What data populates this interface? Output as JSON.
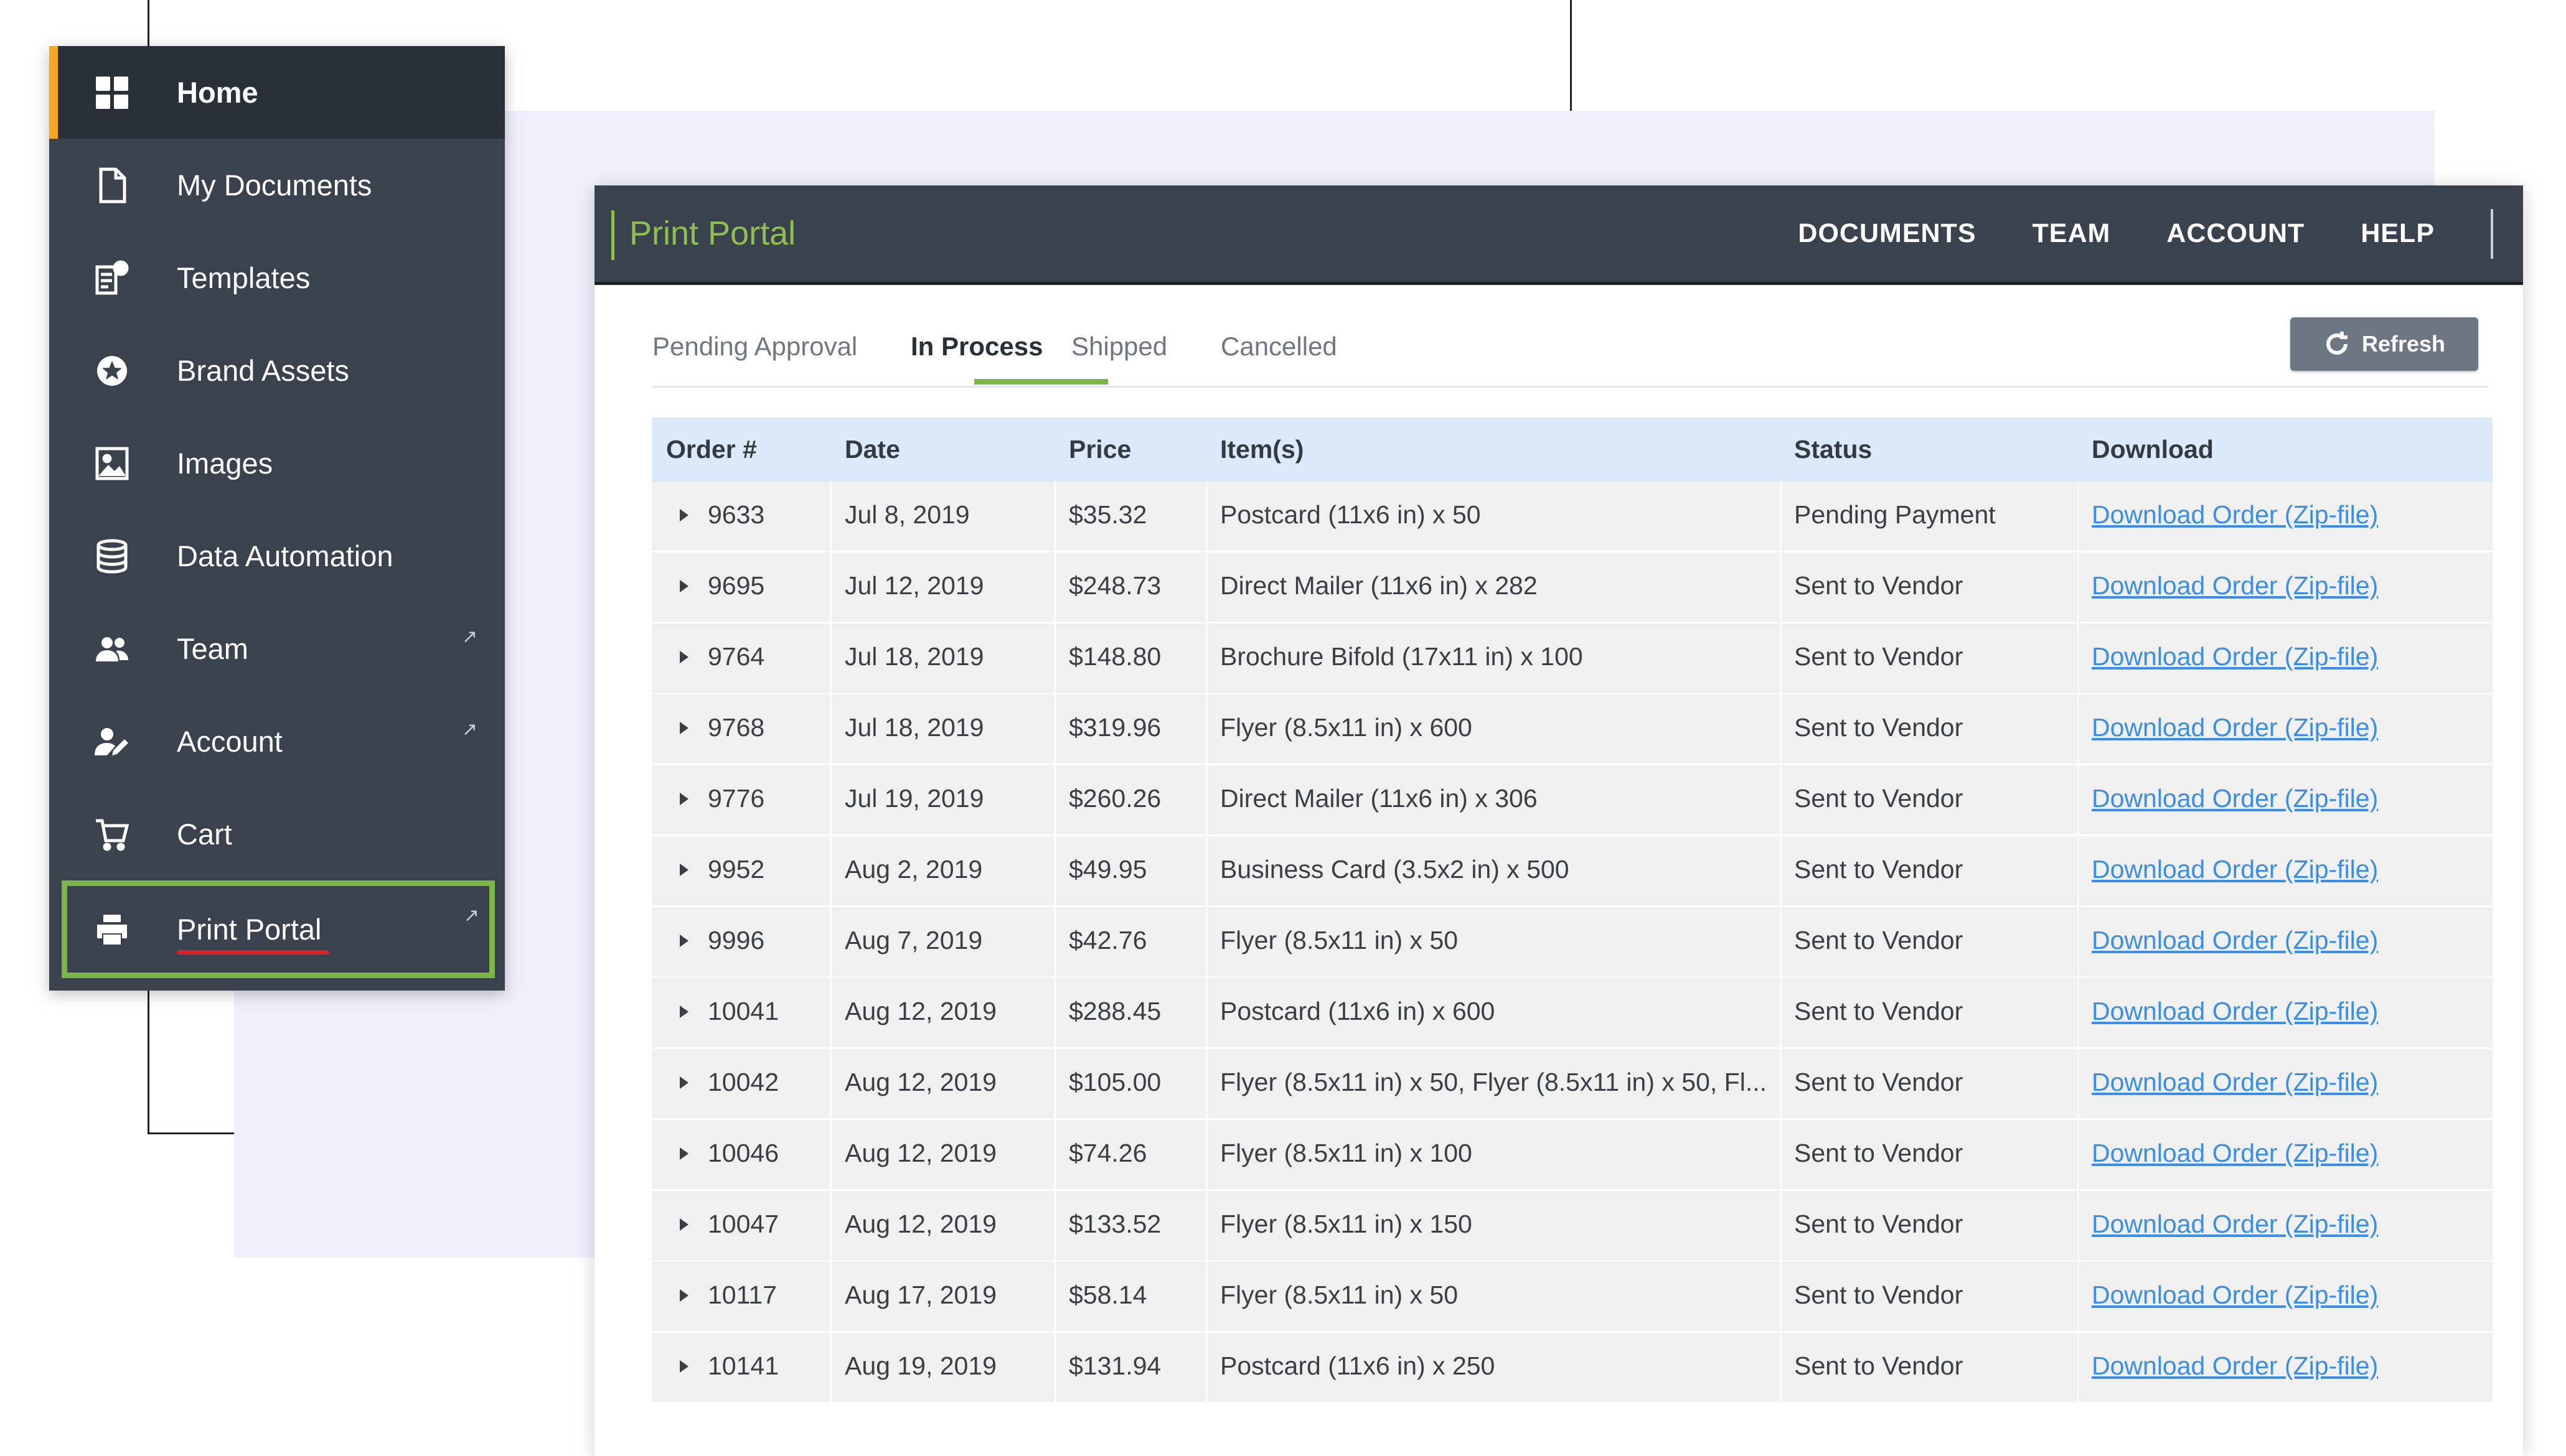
{
  "sidebar": {
    "items": [
      {
        "label": "Home",
        "icon": "grid-icon",
        "active": true
      },
      {
        "label": "My Documents",
        "icon": "document-icon"
      },
      {
        "label": "Templates",
        "icon": "template-icon"
      },
      {
        "label": "Brand Assets",
        "icon": "star-badge-icon"
      },
      {
        "label": "Images",
        "icon": "image-icon"
      },
      {
        "label": "Data Automation",
        "icon": "database-icon"
      },
      {
        "label": "Team",
        "icon": "users-icon",
        "external": true
      },
      {
        "label": "Account",
        "icon": "user-edit-icon",
        "external": true
      },
      {
        "label": "Cart",
        "icon": "cart-icon"
      },
      {
        "label": "Print Portal",
        "icon": "printer-icon",
        "external": true,
        "highlighted": true
      }
    ],
    "ext_glyph": "↗"
  },
  "portal": {
    "brand": "Print Portal",
    "nav": [
      "DOCUMENTS",
      "TEAM",
      "ACCOUNT",
      "HELP"
    ],
    "tabs": [
      "Pending Approval",
      "In Process",
      "Shipped",
      "Cancelled"
    ],
    "active_tab": "In Process",
    "refresh_label": "Refresh",
    "accent_color": "#7ab648",
    "link_color": "#3a8ee8"
  },
  "table": {
    "headers": [
      "Order #",
      "Date",
      "Price",
      "Item(s)",
      "Status",
      "Download"
    ],
    "rows": [
      {
        "order": "9633",
        "date": "Jul 8, 2019",
        "price": "$35.32",
        "items": "Postcard (11x6 in) x 50",
        "status": "Pending Payment",
        "download": "Download Order (Zip-file)"
      },
      {
        "order": "9695",
        "date": "Jul 12, 2019",
        "price": "$248.73",
        "items": "Direct Mailer (11x6 in) x 282",
        "status": "Sent to Vendor",
        "download": "Download Order (Zip-file)"
      },
      {
        "order": "9764",
        "date": "Jul 18, 2019",
        "price": "$148.80",
        "items": "Brochure Bifold (17x11 in) x 100",
        "status": "Sent to Vendor",
        "download": "Download Order (Zip-file)"
      },
      {
        "order": "9768",
        "date": "Jul 18, 2019",
        "price": "$319.96",
        "items": "Flyer (8.5x11 in) x 600",
        "status": "Sent to Vendor",
        "download": "Download Order (Zip-file)"
      },
      {
        "order": "9776",
        "date": "Jul 19, 2019",
        "price": "$260.26",
        "items": "Direct Mailer (11x6 in) x 306",
        "status": "Sent to Vendor",
        "download": "Download Order (Zip-file)"
      },
      {
        "order": "9952",
        "date": "Aug 2, 2019",
        "price": "$49.95",
        "items": "Business Card (3.5x2 in) x 500",
        "status": "Sent to Vendor",
        "download": "Download Order (Zip-file)"
      },
      {
        "order": "9996",
        "date": "Aug 7, 2019",
        "price": "$42.76",
        "items": "Flyer (8.5x11 in) x 50",
        "status": "Sent to Vendor",
        "download": "Download Order (Zip-file)"
      },
      {
        "order": "10041",
        "date": "Aug 12, 2019",
        "price": "$288.45",
        "items": "Postcard (11x6 in) x 600",
        "status": "Sent to Vendor",
        "download": "Download Order (Zip-file)"
      },
      {
        "order": "10042",
        "date": "Aug 12, 2019",
        "price": "$105.00",
        "items": "Flyer (8.5x11 in) x 50, Flyer (8.5x11 in) x 50, Fl...",
        "status": "Sent to Vendor",
        "download": "Download Order (Zip-file)"
      },
      {
        "order": "10046",
        "date": "Aug 12, 2019",
        "price": "$74.26",
        "items": "Flyer (8.5x11 in) x 100",
        "status": "Sent to Vendor",
        "download": "Download Order (Zip-file)"
      },
      {
        "order": "10047",
        "date": "Aug 12, 2019",
        "price": "$133.52",
        "items": "Flyer (8.5x11 in) x 150",
        "status": "Sent to Vendor",
        "download": "Download Order (Zip-file)"
      },
      {
        "order": "10117",
        "date": "Aug 17, 2019",
        "price": "$58.14",
        "items": "Flyer (8.5x11 in) x 50",
        "status": "Sent to Vendor",
        "download": "Download Order (Zip-file)"
      },
      {
        "order": "10141",
        "date": "Aug 19, 2019",
        "price": "$131.94",
        "items": "Postcard (11x6 in) x 250",
        "status": "Sent to Vendor",
        "download": "Download Order (Zip-file)"
      }
    ]
  }
}
